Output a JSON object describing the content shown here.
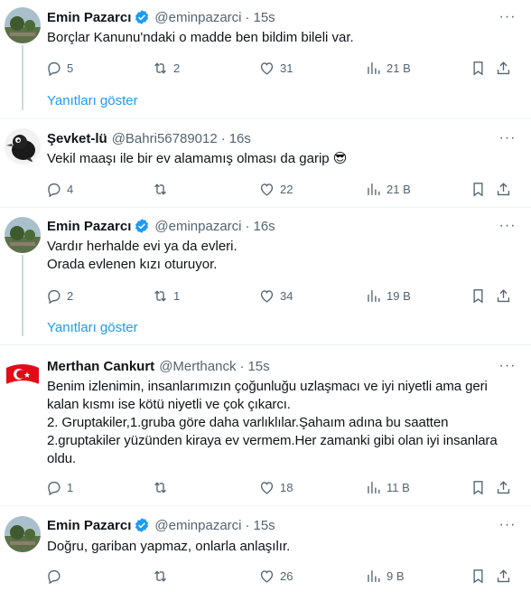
{
  "colors": {
    "accent": "#1d9bf0",
    "muted": "#536471",
    "text": "#0f1419",
    "verified": "#1d9bf0"
  },
  "tweets": [
    {
      "name": "Emin Pazarcı",
      "handle": "@eminpazarci",
      "dot": "·",
      "time": "15s",
      "verified": true,
      "avatar": "landscape-avatar",
      "text": "Borçlar Kanunu'ndaki o madde ben bildim bileli var.",
      "replies": "5",
      "retweets": "2",
      "likes": "31",
      "views": "21 B",
      "show_replies": "Yanıtları göster"
    },
    {
      "name": "Şevket-lü",
      "handle": "@Bahri56789012",
      "dot": "·",
      "time": "16s",
      "verified": false,
      "avatar": "crow-avatar",
      "text": "Vekil maaşı ile bir ev alamamış olması da garip 😎",
      "replies": "4",
      "retweets": "",
      "likes": "22",
      "views": "21 B"
    },
    {
      "name": "Emin Pazarcı",
      "handle": "@eminpazarci",
      "dot": "·",
      "time": "16s",
      "verified": true,
      "avatar": "landscape-avatar",
      "text": "Vardır herhalde evi ya da evleri.\nOrada evlenen kızı oturuyor.",
      "replies": "2",
      "retweets": "1",
      "likes": "34",
      "views": "19 B",
      "show_replies": "Yanıtları göster"
    },
    {
      "name": "Merthan Cankurt",
      "handle": "@Merthanck",
      "dot": "·",
      "time": "15s",
      "verified": false,
      "avatar": "turkish-flag-avatar",
      "text": "Benim izlenimin, insanlarımızın çoğunluğu uzlaşmacı ve iyi niyetli ama geri kalan kısmı ise kötü niyetli ve çok çıkarcı.\n2. Gruptakiler,1.gruba göre daha varlıklılar.Şahaım adına bu saatten 2.gruptakiler yüzünden kiraya ev vermem.Her zamanki gibi olan iyi insanlara oldu.",
      "replies": "1",
      "retweets": "",
      "likes": "18",
      "views": "11 B"
    },
    {
      "name": "Emin Pazarcı",
      "handle": "@eminpazarci",
      "dot": "·",
      "time": "15s",
      "verified": true,
      "avatar": "landscape-avatar",
      "text": "Doğru, gariban yapmaz, onlarla anlaşılır.",
      "replies": "",
      "retweets": "",
      "likes": "26",
      "views": "9 B"
    }
  ]
}
